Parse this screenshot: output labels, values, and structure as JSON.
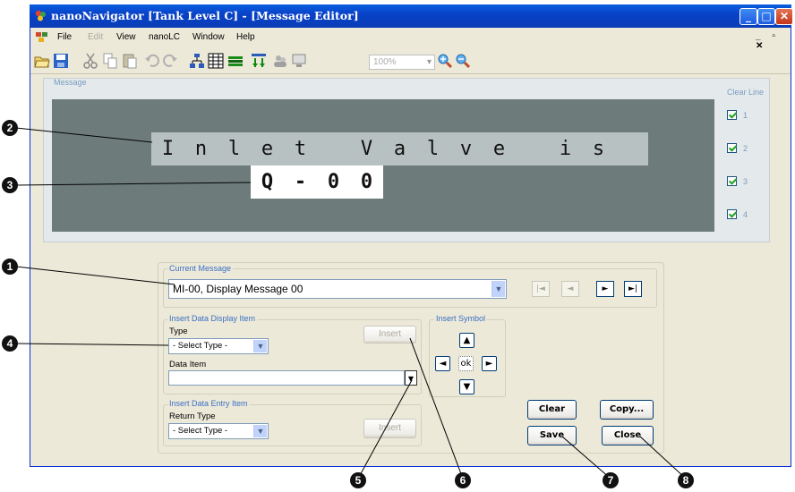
{
  "window": {
    "title": "nanoNavigator [Tank Level C] - [Message Editor]",
    "minimize": "_",
    "maximize": "□",
    "close": "✕",
    "mdi_controls": "_ ▫ ✕"
  },
  "menu": [
    "File",
    "Edit",
    "View",
    "nanoLC",
    "Window",
    "Help"
  ],
  "menu_disabled": [
    "Edit"
  ],
  "toolbar": {
    "icons": [
      "open-icon",
      "save-icon",
      "cut-icon",
      "copy-icon",
      "paste-icon",
      "undo-icon",
      "redo-icon",
      "hierarchy-icon",
      "table-icon",
      "bars-icon",
      "download-icon",
      "users-icon",
      "monitor-icon"
    ],
    "zoom": "100%"
  },
  "message": {
    "label": "Message",
    "clear_line_label": "Clear Line",
    "rows": [
      {
        "cells": [
          "",
          "",
          "",
          "",
          "",
          "",
          "",
          "",
          "",
          "",
          "",
          "",
          "",
          "",
          "",
          "",
          "",
          "",
          "",
          ""
        ],
        "line": "1"
      },
      {
        "cells": [
          "",
          "",
          "",
          "I",
          "n",
          "l",
          "e",
          "t",
          "",
          "V",
          "a",
          "l",
          "v",
          "e",
          "",
          "i",
          "s",
          "",
          "",
          ""
        ],
        "line": "2"
      },
      {
        "cells": [
          "",
          "",
          "",
          "",
          "",
          "",
          "Q",
          "-",
          "0",
          "0",
          "",
          "",
          "",
          "",
          "",
          "",
          "",
          "",
          "",
          ""
        ],
        "line": "3"
      },
      {
        "cells": [
          "",
          "",
          "",
          "",
          "",
          "",
          "",
          "",
          "",
          "",
          "",
          "",
          "",
          "",
          "",
          "",
          "",
          "",
          "",
          ""
        ],
        "line": "4"
      }
    ],
    "row_text": {
      "r2": [
        "I",
        "n",
        "l",
        "e",
        "t",
        "V",
        "a",
        "l",
        "v",
        "e",
        "i",
        "s"
      ],
      "r3": [
        "Q",
        "-",
        "0",
        "0"
      ]
    }
  },
  "current_message": {
    "label": "Current Message",
    "value": "MI-00,  Display Message 00",
    "nav": {
      "first": "|◄",
      "prev": "◄",
      "next": "►",
      "last": "►|"
    }
  },
  "insert_display": {
    "label": "Insert Data Display Item",
    "type_label": "Type",
    "type_value": "- Select Type -",
    "data_item_label": "Data Item",
    "data_item_value": "",
    "insert_button": "Insert"
  },
  "insert_symbol": {
    "label": "Insert Symbol",
    "up": "▲",
    "left": "◄",
    "ok": "ok",
    "right": "►",
    "down": "▼"
  },
  "insert_entry": {
    "label": "Insert Data Entry Item",
    "return_type_label": "Return Type",
    "return_type_value": "- Select Type -",
    "insert_button": "Insert"
  },
  "actions": {
    "clear": "Clear",
    "copy": "Copy...",
    "save": "Save",
    "close": "Close"
  },
  "callouts": [
    "1",
    "2",
    "3",
    "4",
    "5",
    "6",
    "7",
    "8"
  ]
}
